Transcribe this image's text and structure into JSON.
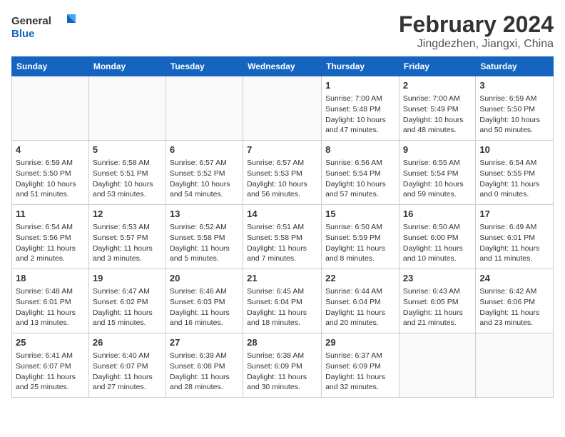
{
  "logo": {
    "line1": "General",
    "line2": "Blue"
  },
  "title": "February 2024",
  "subtitle": "Jingdezhen, Jiangxi, China",
  "days_of_week": [
    "Sunday",
    "Monday",
    "Tuesday",
    "Wednesday",
    "Thursday",
    "Friday",
    "Saturday"
  ],
  "weeks": [
    [
      {
        "num": "",
        "info": ""
      },
      {
        "num": "",
        "info": ""
      },
      {
        "num": "",
        "info": ""
      },
      {
        "num": "",
        "info": ""
      },
      {
        "num": "1",
        "info": "Sunrise: 7:00 AM\nSunset: 5:48 PM\nDaylight: 10 hours and 47 minutes."
      },
      {
        "num": "2",
        "info": "Sunrise: 7:00 AM\nSunset: 5:49 PM\nDaylight: 10 hours and 48 minutes."
      },
      {
        "num": "3",
        "info": "Sunrise: 6:59 AM\nSunset: 5:50 PM\nDaylight: 10 hours and 50 minutes."
      }
    ],
    [
      {
        "num": "4",
        "info": "Sunrise: 6:59 AM\nSunset: 5:50 PM\nDaylight: 10 hours and 51 minutes."
      },
      {
        "num": "5",
        "info": "Sunrise: 6:58 AM\nSunset: 5:51 PM\nDaylight: 10 hours and 53 minutes."
      },
      {
        "num": "6",
        "info": "Sunrise: 6:57 AM\nSunset: 5:52 PM\nDaylight: 10 hours and 54 minutes."
      },
      {
        "num": "7",
        "info": "Sunrise: 6:57 AM\nSunset: 5:53 PM\nDaylight: 10 hours and 56 minutes."
      },
      {
        "num": "8",
        "info": "Sunrise: 6:56 AM\nSunset: 5:54 PM\nDaylight: 10 hours and 57 minutes."
      },
      {
        "num": "9",
        "info": "Sunrise: 6:55 AM\nSunset: 5:54 PM\nDaylight: 10 hours and 59 minutes."
      },
      {
        "num": "10",
        "info": "Sunrise: 6:54 AM\nSunset: 5:55 PM\nDaylight: 11 hours and 0 minutes."
      }
    ],
    [
      {
        "num": "11",
        "info": "Sunrise: 6:54 AM\nSunset: 5:56 PM\nDaylight: 11 hours and 2 minutes."
      },
      {
        "num": "12",
        "info": "Sunrise: 6:53 AM\nSunset: 5:57 PM\nDaylight: 11 hours and 3 minutes."
      },
      {
        "num": "13",
        "info": "Sunrise: 6:52 AM\nSunset: 5:58 PM\nDaylight: 11 hours and 5 minutes."
      },
      {
        "num": "14",
        "info": "Sunrise: 6:51 AM\nSunset: 5:58 PM\nDaylight: 11 hours and 7 minutes."
      },
      {
        "num": "15",
        "info": "Sunrise: 6:50 AM\nSunset: 5:59 PM\nDaylight: 11 hours and 8 minutes."
      },
      {
        "num": "16",
        "info": "Sunrise: 6:50 AM\nSunset: 6:00 PM\nDaylight: 11 hours and 10 minutes."
      },
      {
        "num": "17",
        "info": "Sunrise: 6:49 AM\nSunset: 6:01 PM\nDaylight: 11 hours and 11 minutes."
      }
    ],
    [
      {
        "num": "18",
        "info": "Sunrise: 6:48 AM\nSunset: 6:01 PM\nDaylight: 11 hours and 13 minutes."
      },
      {
        "num": "19",
        "info": "Sunrise: 6:47 AM\nSunset: 6:02 PM\nDaylight: 11 hours and 15 minutes."
      },
      {
        "num": "20",
        "info": "Sunrise: 6:46 AM\nSunset: 6:03 PM\nDaylight: 11 hours and 16 minutes."
      },
      {
        "num": "21",
        "info": "Sunrise: 6:45 AM\nSunset: 6:04 PM\nDaylight: 11 hours and 18 minutes."
      },
      {
        "num": "22",
        "info": "Sunrise: 6:44 AM\nSunset: 6:04 PM\nDaylight: 11 hours and 20 minutes."
      },
      {
        "num": "23",
        "info": "Sunrise: 6:43 AM\nSunset: 6:05 PM\nDaylight: 11 hours and 21 minutes."
      },
      {
        "num": "24",
        "info": "Sunrise: 6:42 AM\nSunset: 6:06 PM\nDaylight: 11 hours and 23 minutes."
      }
    ],
    [
      {
        "num": "25",
        "info": "Sunrise: 6:41 AM\nSunset: 6:07 PM\nDaylight: 11 hours and 25 minutes."
      },
      {
        "num": "26",
        "info": "Sunrise: 6:40 AM\nSunset: 6:07 PM\nDaylight: 11 hours and 27 minutes."
      },
      {
        "num": "27",
        "info": "Sunrise: 6:39 AM\nSunset: 6:08 PM\nDaylight: 11 hours and 28 minutes."
      },
      {
        "num": "28",
        "info": "Sunrise: 6:38 AM\nSunset: 6:09 PM\nDaylight: 11 hours and 30 minutes."
      },
      {
        "num": "29",
        "info": "Sunrise: 6:37 AM\nSunset: 6:09 PM\nDaylight: 11 hours and 32 minutes."
      },
      {
        "num": "",
        "info": ""
      },
      {
        "num": "",
        "info": ""
      }
    ]
  ]
}
